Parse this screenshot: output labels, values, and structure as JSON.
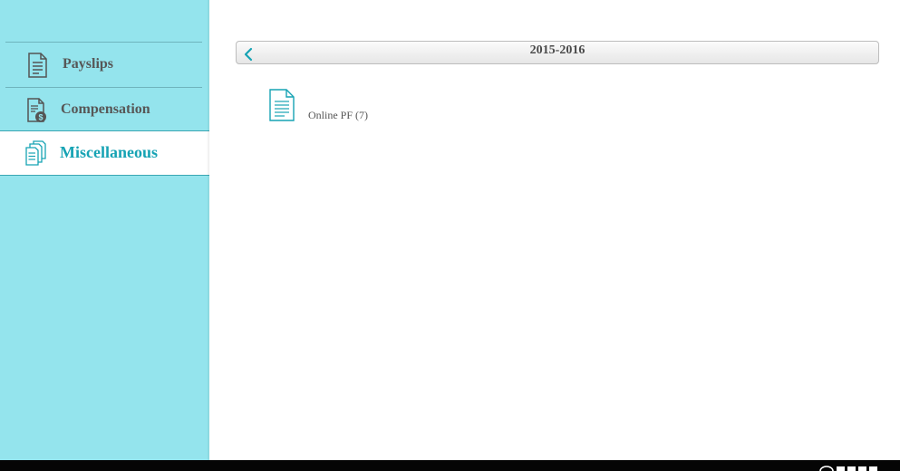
{
  "sidebar": {
    "items": [
      {
        "label": "Payslips",
        "icon": "payslip-document-icon"
      },
      {
        "label": "Compensation",
        "icon": "money-bag-document-icon"
      },
      {
        "label": "Miscellaneous",
        "icon": "stacked-documents-icon",
        "active": true
      }
    ]
  },
  "main": {
    "year": "2015-2016",
    "back_icon": "chevron-left-icon",
    "documents": [
      {
        "label": "Online PF (7)",
        "icon": "document-icon"
      }
    ]
  },
  "colors": {
    "sidebar_bg": "#94e4ed",
    "accent": "#16a3b4",
    "footer": "#050505"
  }
}
